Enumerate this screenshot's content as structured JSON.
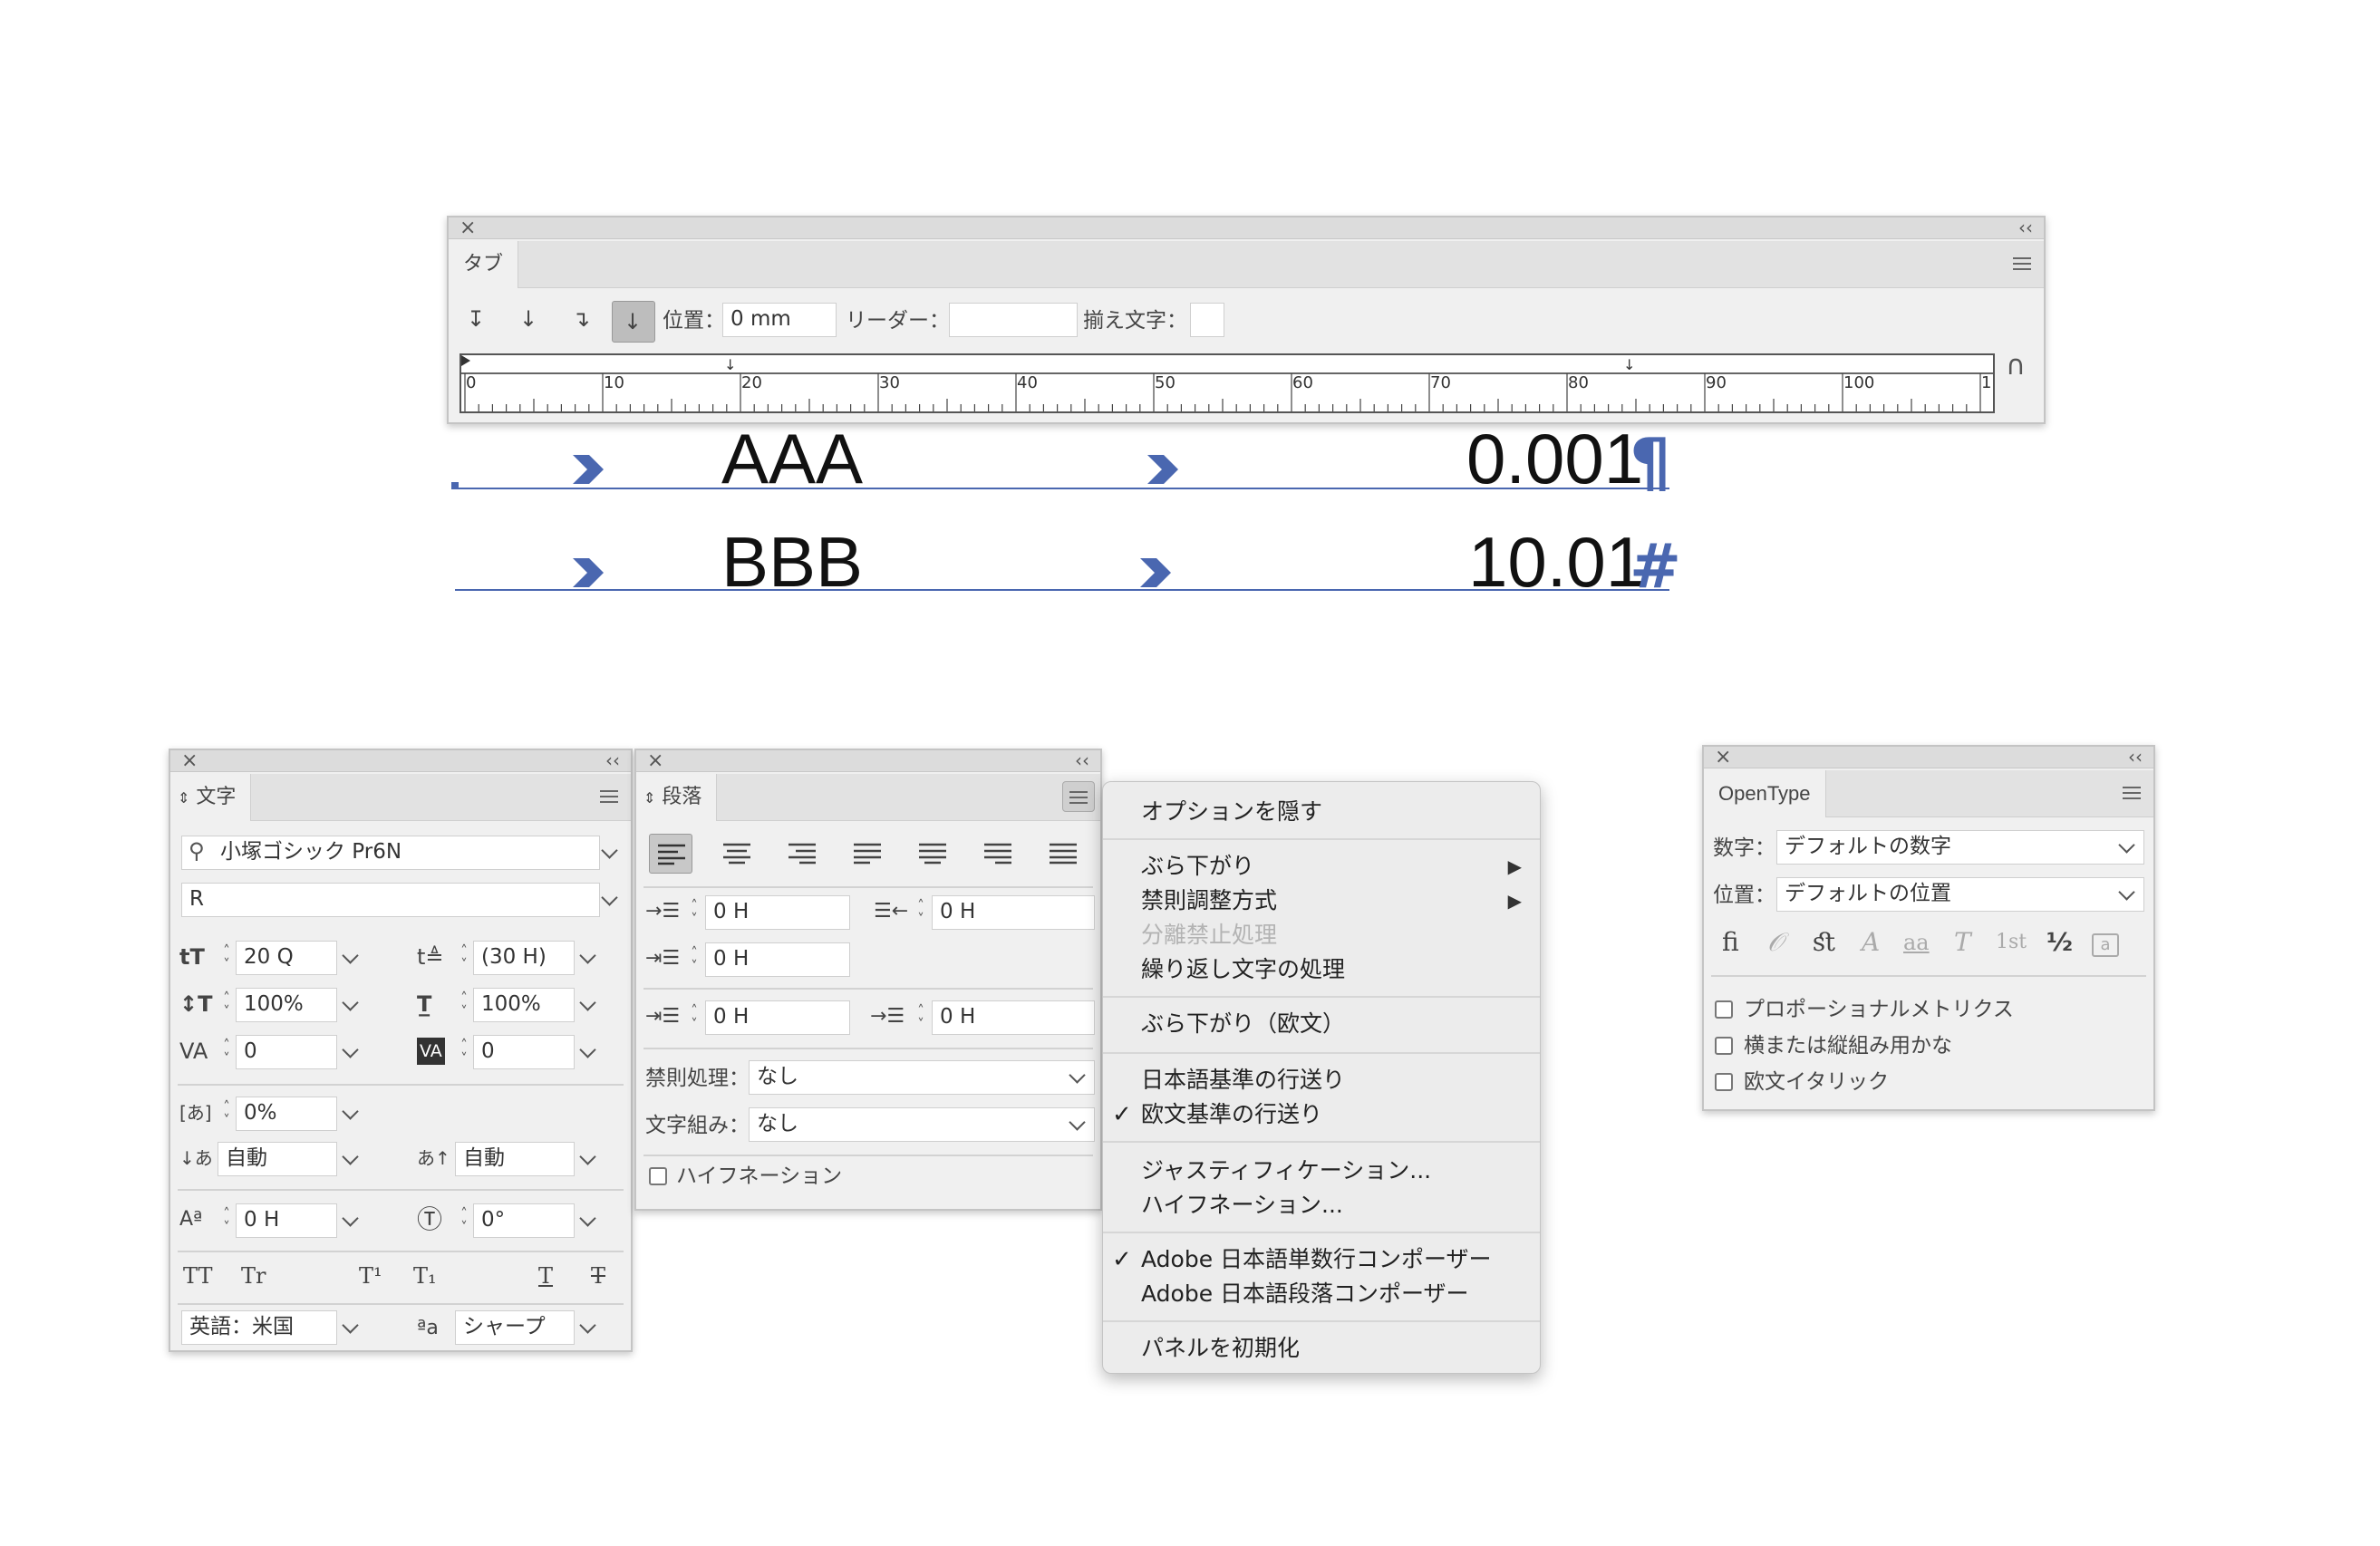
{
  "tab_panel": {
    "tab_label": "タブ",
    "position_label": "位置：",
    "position_value": "0 mm",
    "leader_label": "リーダー：",
    "leader_value": "",
    "align_label": "揃え文字：",
    "align_value": "",
    "ruler_labels": [
      "0",
      "10",
      "20",
      "30",
      "40",
      "50",
      "60",
      "70",
      "80",
      "90",
      "100",
      "1"
    ]
  },
  "document": {
    "row1_left": "AAA",
    "row1_right": "0.001",
    "row2_left": "BBB",
    "row2_right": "10.01",
    "accent_color": "#4a67b0"
  },
  "char_panel": {
    "tab_label": "文字",
    "font_family": "小塚ゴシック Pr6N",
    "font_style": "R",
    "font_size": "20 Q",
    "leading": "(30 H)",
    "vertical_scale": "100%",
    "horizontal_scale": "100%",
    "kerning": "0",
    "tracking": "0",
    "tsume": "0%",
    "aki_before": "自動",
    "aki_after": "自動",
    "baseline_shift": "0 H",
    "rotation": "0°",
    "language": "英語：米国",
    "antialias": "シャープ",
    "tt_allcaps": "TT",
    "tt_smallcaps": "Tr",
    "tt_super": "T¹",
    "tt_sub": "T₁",
    "tt_underline": "T",
    "tt_strike": "T",
    "aa_icon_text": "ªa"
  },
  "para_panel": {
    "tab_label": "段落",
    "left_indent": "0 H",
    "right_indent": "0 H",
    "first_line_indent": "0 H",
    "space_before": "0 H",
    "space_after": "0 H",
    "kinsoku_label": "禁則処理：",
    "kinsoku_value": "なし",
    "mojikumi_label": "文字組み：",
    "mojikumi_value": "なし",
    "hyphenation_label": "ハイフネーション"
  },
  "menu": {
    "hide_options": "オプションを隠す",
    "burasagari": "ぶら下がり",
    "kinsoku_method": "禁則調整方式",
    "bunri_kinshi": "分離禁止処理",
    "repeat_char": "繰り返し文字の処理",
    "burasagari_roman": "ぶら下がり（欧文）",
    "jp_leading": "日本語基準の行送り",
    "roman_leading": "欧文基準の行送り",
    "justification": "ジャスティフィケーション...",
    "hyphenation": "ハイフネーション...",
    "single_line_composer": "Adobe 日本語単数行コンポーザー",
    "paragraph_composer": "Adobe 日本語段落コンポーザー",
    "reset_panel": "パネルを初期化"
  },
  "opentype_panel": {
    "tab_label": "OpenType",
    "figures_label": "数字：",
    "figures_value": "デフォルトの数字",
    "position_label": "位置：",
    "position_value": "デフォルトの位置",
    "proportional_metrics": "プロポーショナルメトリクス",
    "kana": "横または縦組み用かな",
    "italic": "欧文イタリック",
    "glyph_fi": "ﬁ",
    "glyph_swash": "𝒪",
    "glyph_st": "ﬆ",
    "glyph_titling": "A",
    "glyph_aa": "aa",
    "glyph_t": "T",
    "glyph_ordinal": "1st",
    "glyph_fraction": "½",
    "glyph_ornament": "a"
  }
}
